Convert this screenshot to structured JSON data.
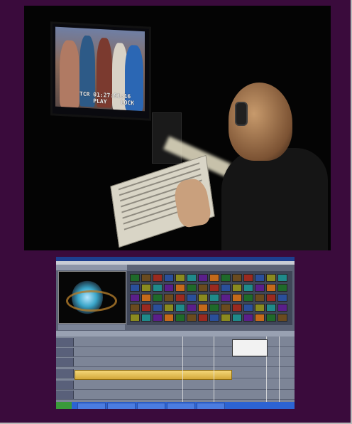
{
  "photo": {
    "tv_osd_line1": "TCR 01:27:51:16",
    "tv_osd_line2": "PLAY",
    "tv_osd_line2_suffix": "LOCK"
  },
  "software_screenshot": {
    "taskbar": {
      "start_label": "start"
    }
  }
}
